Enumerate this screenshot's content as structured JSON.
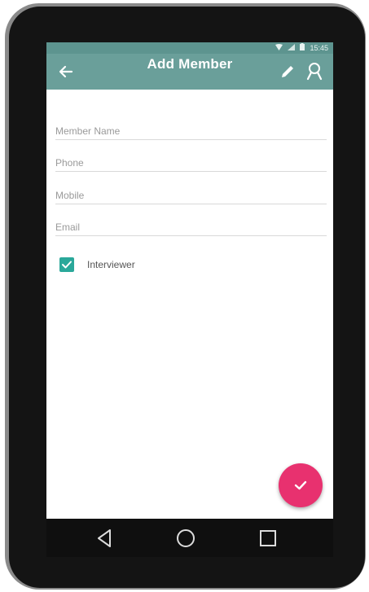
{
  "status_bar": {
    "time": "15:45",
    "wifi_icon": "wifi-icon",
    "signal_icon": "signal-icon",
    "battery_icon": "battery-icon"
  },
  "toolbar": {
    "title": "Add Member",
    "back_icon": "arrow-back-icon",
    "edit_icon": "pencil-icon",
    "badge_icon": "ribbon-badge-icon",
    "color": "#6a9f9a"
  },
  "form": {
    "fields": [
      {
        "placeholder": "Member Name",
        "value": ""
      },
      {
        "placeholder": "Phone",
        "value": ""
      },
      {
        "placeholder": "Mobile",
        "value": ""
      },
      {
        "placeholder": "Email",
        "value": ""
      }
    ],
    "checkbox": {
      "label": "Interviewer",
      "checked": true,
      "color": "#2aa89a"
    }
  },
  "fab": {
    "icon": "check-icon",
    "color": "#e8316f"
  },
  "nav_bar": {
    "back_icon": "nav-back-triangle-icon",
    "home_icon": "nav-home-circle-icon",
    "recents_icon": "nav-recents-square-icon"
  }
}
